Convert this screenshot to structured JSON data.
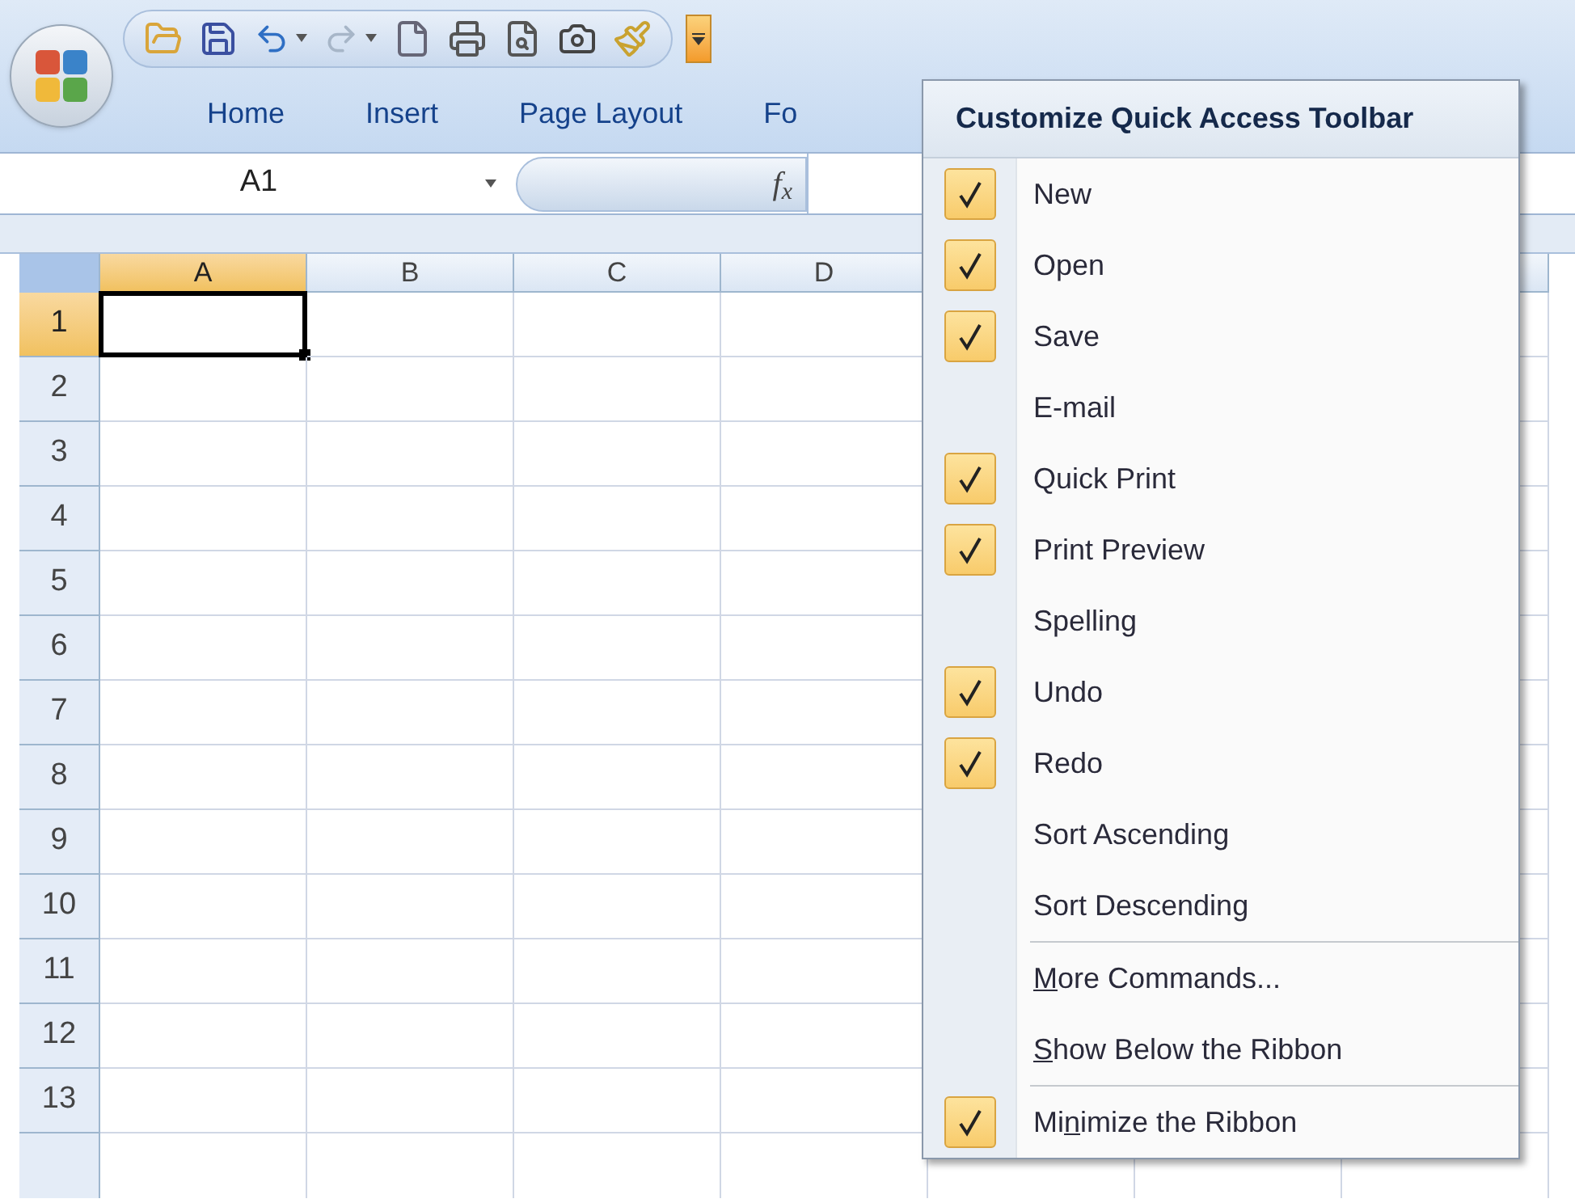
{
  "customize_button": {
    "expanded": true
  },
  "ribbon_tabs": [
    {
      "label": "Home"
    },
    {
      "label": "Insert"
    },
    {
      "label": "Page Layout"
    },
    {
      "label": "Fo"
    }
  ],
  "formula_bar": {
    "name_box": "A1",
    "function_label": "f$_{x}$"
  },
  "sheet": {
    "columns": [
      {
        "label": "A",
        "selected": true
      },
      {
        "label": "B",
        "selected": false
      },
      {
        "label": "C",
        "selected": false
      },
      {
        "label": "D",
        "selected": false
      }
    ],
    "rows": [
      {
        "label": "1",
        "selected": true
      },
      {
        "label": "2",
        "selected": false
      },
      {
        "label": "3",
        "selected": false
      },
      {
        "label": "4",
        "selected": false
      },
      {
        "label": "5",
        "selected": false
      },
      {
        "label": "6",
        "selected": false
      },
      {
        "label": "7",
        "selected": false
      },
      {
        "label": "8",
        "selected": false
      },
      {
        "label": "9",
        "selected": false
      },
      {
        "label": "10",
        "selected": false
      },
      {
        "label": "11",
        "selected": false
      },
      {
        "label": "12",
        "selected": false
      },
      {
        "label": "13",
        "selected": false
      }
    ]
  },
  "menu": {
    "title": "Customize Quick Access Toolbar",
    "sections": [
      [
        {
          "label": [
            {
              "text": "New",
              "underline": false
            }
          ],
          "checked": true
        },
        {
          "label": [
            {
              "text": "Open",
              "underline": false
            }
          ],
          "checked": true
        },
        {
          "label": [
            {
              "text": "Save",
              "underline": false
            }
          ],
          "checked": true
        },
        {
          "label": [
            {
              "text": "E-mail",
              "underline": false
            }
          ],
          "checked": false
        },
        {
          "label": [
            {
              "text": "Quick Print",
              "underline": false
            }
          ],
          "checked": true
        },
        {
          "label": [
            {
              "text": "Print Preview",
              "underline": false
            }
          ],
          "checked": true
        },
        {
          "label": [
            {
              "text": "Spelling",
              "underline": false
            }
          ],
          "checked": false
        },
        {
          "label": [
            {
              "text": "Undo",
              "underline": false
            }
          ],
          "checked": true
        },
        {
          "label": [
            {
              "text": "Redo",
              "underline": false
            }
          ],
          "checked": true
        },
        {
          "label": [
            {
              "text": "Sort Ascending",
              "underline": false
            }
          ],
          "checked": false
        },
        {
          "label": [
            {
              "text": "Sort Descending",
              "underline": false
            }
          ],
          "checked": false
        }
      ],
      [
        {
          "label": [
            {
              "text": "M",
              "underline": true
            },
            {
              "text": "ore Commands...",
              "underline": false
            }
          ]
        },
        {
          "label": [
            {
              "text": "S",
              "underline": true
            },
            {
              "text": "how Below the Ribbon",
              "underline": false
            }
          ]
        }
      ],
      [
        {
          "label": [
            {
              "text": "Mi",
              "underline": false
            },
            {
              "text": "n",
              "underline": true
            },
            {
              "text": "imize the Ribbon",
              "underline": false
            }
          ],
          "checked": true
        }
      ]
    ]
  }
}
